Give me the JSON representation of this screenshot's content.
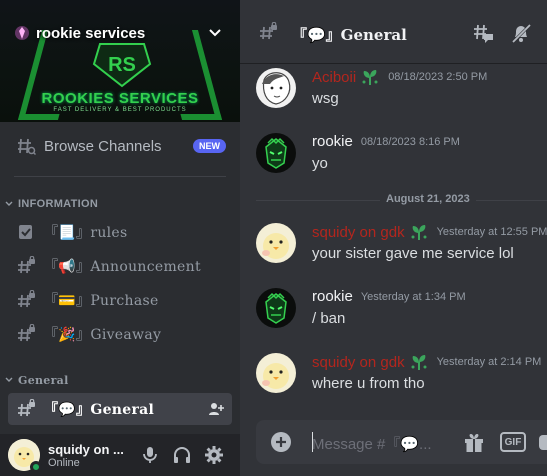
{
  "server": {
    "name": "rookie services",
    "banner_title": "ROOKIES SERVICES",
    "banner_subtitle": "FAST DELIVERY & BEST PRODUCTS",
    "logo_letters": "RS"
  },
  "browse": {
    "label": "Browse Channels",
    "badge": "NEW"
  },
  "categories": {
    "information": "INFORMATION",
    "general": "General"
  },
  "channels": [
    {
      "name": "『📃』rules",
      "icon": "rules-check-icon"
    },
    {
      "name": "『📢』Announcement",
      "icon": "hash-lock-icon"
    },
    {
      "name": "『💳』Purchase",
      "icon": "hash-lock-icon"
    },
    {
      "name": "『🎉』Giveaway",
      "icon": "hash-lock-icon"
    },
    {
      "name": "『💬』General",
      "icon": "hash-lock-icon"
    }
  ],
  "user": {
    "name": "squidy on ...",
    "status": "Online"
  },
  "header": {
    "title": "『💬』General"
  },
  "messages": [
    {
      "author": "Aciboii",
      "timestamp": "08/18/2023 2:50 PM",
      "text": "wsg",
      "author_color": "#b3261e"
    },
    {
      "author": "rookie",
      "timestamp": "08/18/2023 8:16 PM",
      "text": "yo",
      "author_color": "#f2f3f5"
    },
    {
      "author": "squidy on gdk",
      "timestamp": "Yesterday at 12:55 PM",
      "text": "your sister gave me service lol",
      "author_color": "#b3261e"
    },
    {
      "author": "rookie",
      "timestamp": "Yesterday at 1:34 PM",
      "text": "/ ban",
      "author_color": "#f2f3f5"
    },
    {
      "author": "squidy on gdk",
      "timestamp": "Yesterday at 2:14 PM",
      "text": "where u from tho",
      "author_color": "#b3261e"
    }
  ],
  "date_divider": "August 21, 2023",
  "composer": {
    "placeholder": "Message #『💬...",
    "gif_label": "GIF"
  },
  "colors": {
    "accent": "#5865f2",
    "online": "#23a55a",
    "brand_green": "#1fae3b",
    "role_red": "#b3261e"
  }
}
